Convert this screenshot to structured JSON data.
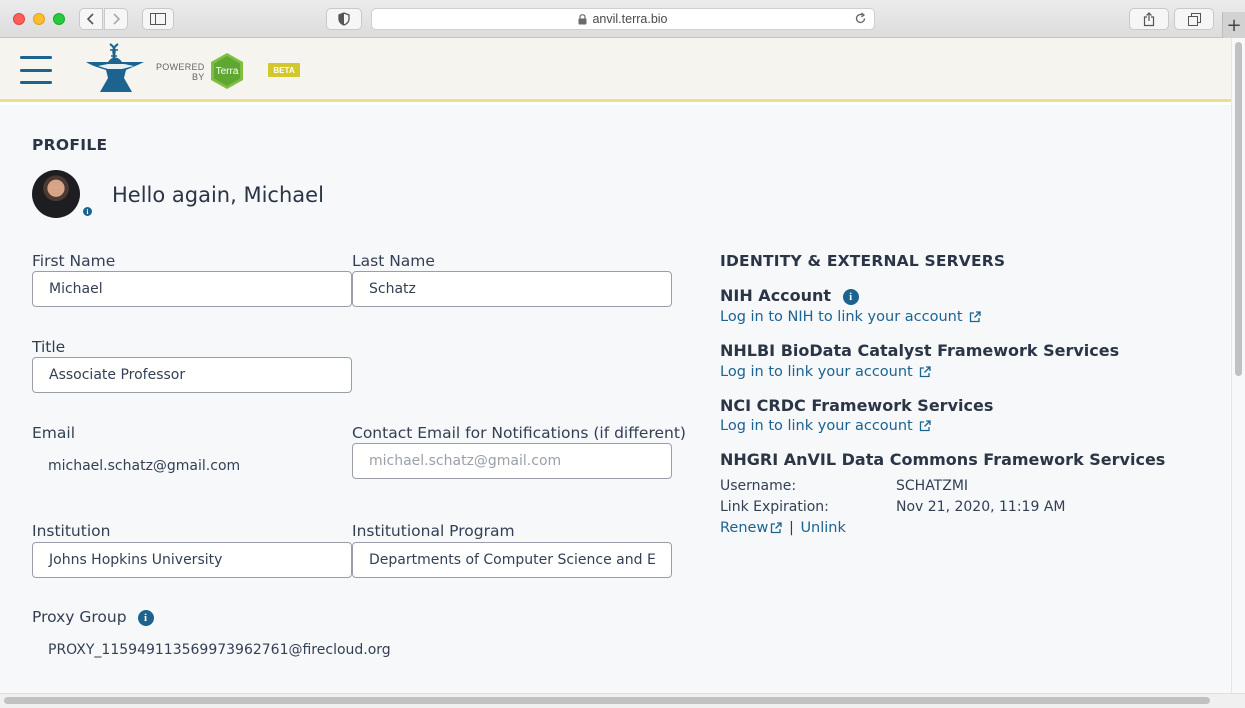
{
  "browser": {
    "url": "anvil.terra.bio"
  },
  "header": {
    "powered_line1": "POWERED",
    "powered_line2": "BY",
    "terra_label": "Terra",
    "beta_label": "BETA"
  },
  "profile": {
    "title": "PROFILE",
    "greeting": "Hello again, Michael",
    "first_name_label": "First Name",
    "first_name_value": "Michael",
    "last_name_label": "Last Name",
    "last_name_value": "Schatz",
    "title_label": "Title",
    "title_value": "Associate Professor",
    "email_label": "Email",
    "email_value": "michael.schatz@gmail.com",
    "contact_email_label": "Contact Email for Notifications (if different)",
    "contact_email_placeholder": "michael.schatz@gmail.com",
    "institution_label": "Institution",
    "institution_value": "Johns Hopkins University",
    "program_label": "Institutional Program",
    "program_value": "Departments of Computer Science and E",
    "proxy_group_label": "Proxy Group",
    "proxy_group_value": "PROXY_115949113569973962761@firecloud.org"
  },
  "identity": {
    "title": "IDENTITY & EXTERNAL SERVERS",
    "nih_name": "NIH Account",
    "nih_link": "Log in to NIH to link your account",
    "nhlbi_name": "NHLBI BioData Catalyst Framework Services",
    "nhlbi_link": "Log in to link your account",
    "nci_name": "NCI CRDC Framework Services",
    "nci_link": "Log in to link your account",
    "nhgri_name": "NHGRI AnVIL Data Commons Framework Services",
    "username_label": "Username:",
    "username_value": "SCHATZMI",
    "expiration_label": "Link Expiration:",
    "expiration_value": "Nov 21, 2020, 11:19 AM",
    "renew_label": "Renew",
    "separator": "|",
    "unlink_label": "Unlink"
  },
  "colors": {
    "accent": "#1c6390",
    "header_bg": "#f5f4ef",
    "content_bg": "#f7f8fa",
    "beta": "#d2c72d",
    "terra_green": "#7fbf3f"
  }
}
